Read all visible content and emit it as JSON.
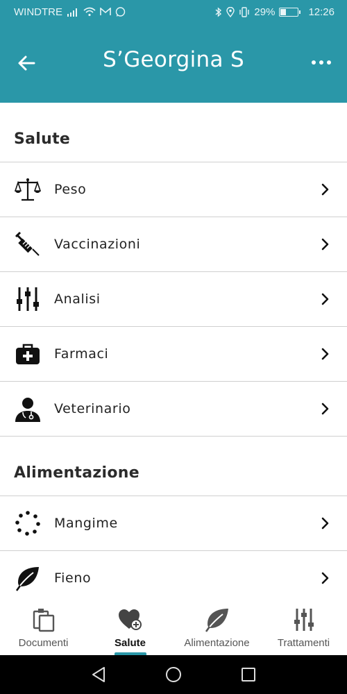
{
  "status_bar": {
    "carrier": "WINDTRE",
    "battery": "29%",
    "battery_level": 0.29,
    "time": "12:26"
  },
  "app_bar": {
    "title": "S’Georgina S"
  },
  "sections": [
    {
      "title": "Salute",
      "items": [
        {
          "label": "Peso",
          "icon": "scale-icon"
        },
        {
          "label": "Vaccinazioni",
          "icon": "syringe-icon"
        },
        {
          "label": "Analisi",
          "icon": "sliders-icon"
        },
        {
          "label": "Farmaci",
          "icon": "medical-kit-icon"
        },
        {
          "label": "Veterinario",
          "icon": "doctor-icon"
        }
      ]
    },
    {
      "title": "Alimentazione",
      "items": [
        {
          "label": "Mangime",
          "icon": "dots-circle-icon"
        },
        {
          "label": "Fieno",
          "icon": "leaf-icon"
        }
      ]
    }
  ],
  "bottom_nav": [
    {
      "label": "Documenti",
      "icon": "documents-icon",
      "active": false
    },
    {
      "label": "Salute",
      "icon": "heart-plus-icon",
      "active": true
    },
    {
      "label": "Alimentazione",
      "icon": "leaf-icon",
      "active": false
    },
    {
      "label": "Trattamenti",
      "icon": "sliders-icon",
      "active": false
    }
  ],
  "colors": {
    "primary": "#2a97a8",
    "text": "#222222",
    "divider": "#cfcfcf"
  }
}
